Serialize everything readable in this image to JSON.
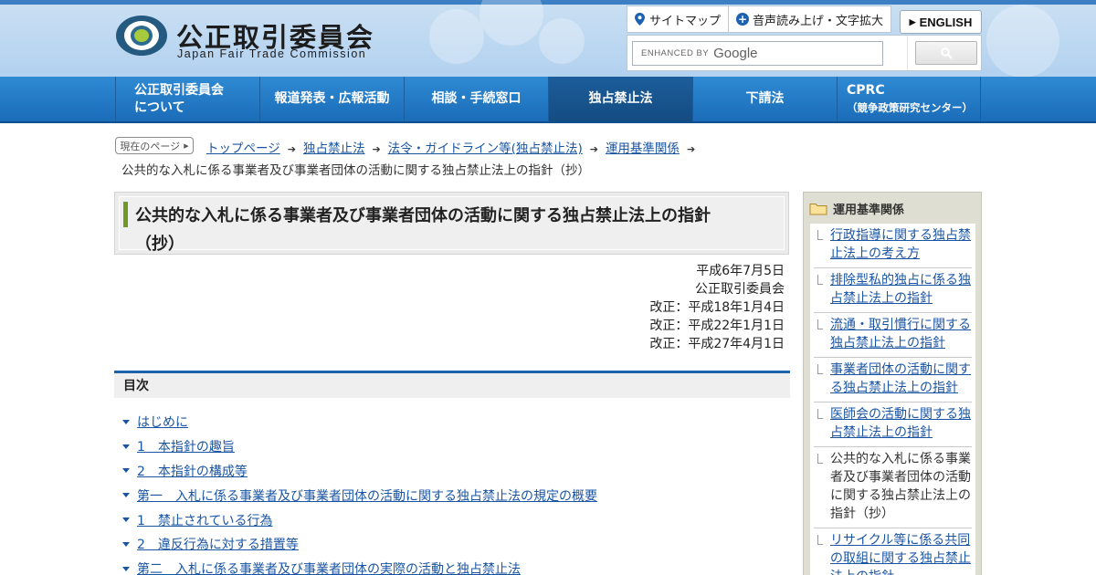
{
  "header": {
    "title": "公正取引委員会",
    "subtitle": "Japan Fair Trade Commission",
    "utility": {
      "sitemap": "サイトマップ",
      "accessibility": "音声読み上げ・文字拡大"
    },
    "english_label": "ENGLISH",
    "search": {
      "enhanced_by": "ENHANCED BY",
      "google": "Google"
    }
  },
  "nav": {
    "items": [
      {
        "line1": "公正取引委員会",
        "line2": "について"
      },
      {
        "label": "報道発表・広報活動"
      },
      {
        "label": "相談・手続窓口"
      },
      {
        "label": "独占禁止法"
      },
      {
        "label": "下請法"
      },
      {
        "line1": "CPRC",
        "line2": "（競争政策研究センター）"
      }
    ]
  },
  "breadcrumb": {
    "badge": "現在のページ",
    "items": [
      "トップページ",
      "独占禁止法",
      "法令・ガイドライン等(独占禁止法)",
      "運用基準関係"
    ],
    "current": "公共的な入札に係る事業者及び事業者団体の活動に関する独占禁止法上の指針（抄）"
  },
  "page": {
    "title_line1": "公共的な入札に係る事業者及び事業者団体の活動に関する独占禁止法上の指針",
    "title_line2": "（抄）",
    "dates": [
      "平成6年7月5日",
      "公正取引委員会",
      "改正：平成18年1月4日",
      "改正：平成22年1月1日",
      "改正：平成27年4月1日"
    ]
  },
  "toc": {
    "heading": "目次",
    "items": [
      "はじめに",
      "1　本指針の趣旨",
      "2　本指針の構成等",
      "第一　入札に係る事業者及び事業者団体の活動に関する独占禁止法の規定の概要",
      "1　禁止されている行為",
      "2　違反行為に対する措置等",
      "第二　入札に係る事業者及び事業者団体の実際の活動と独占禁止法"
    ]
  },
  "sidebar": {
    "heading": "運用基準関係",
    "items": [
      {
        "label": "行政指導に関する独占禁止法上の考え方"
      },
      {
        "label": "排除型私的独占に係る独占禁止法上の指針"
      },
      {
        "label": "流通・取引慣行に関する独占禁止法上の指針"
      },
      {
        "label": "事業者団体の活動に関する独占禁止法上の指針"
      },
      {
        "label": "医師会の活動に関する独占禁止法上の指針"
      },
      {
        "label": "公共的な入札に係る事業者及び事業者団体の活動に関する独占禁止法上の指針（抄）"
      },
      {
        "label": "リサイクル等に係る共同の取組に関する独占禁止法上の指針"
      }
    ]
  },
  "colors": {
    "nav_blue": "#1b6cb8",
    "link": "#1a55a4",
    "title_accent": "#6f9a24"
  }
}
